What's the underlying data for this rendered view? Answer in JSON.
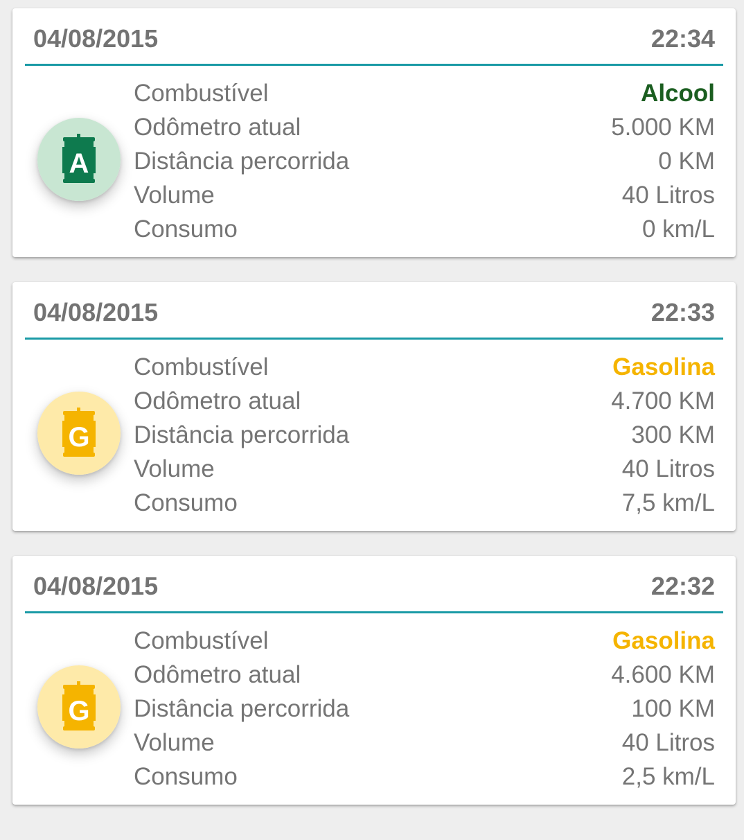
{
  "labels": {
    "fuel": "Combustível",
    "odometer": "Odômetro atual",
    "distance": "Distância percorrida",
    "volume": "Volume",
    "consumption": "Consumo"
  },
  "entries": [
    {
      "date": "04/08/2015",
      "time": "22:34",
      "fuel": "Alcool",
      "fuel_color": "#1b5e20",
      "icon": "fuel-can-alcool-icon",
      "icon_letter": "A",
      "icon_color": "#0e7a4e",
      "icon_bg": "#c8e6d2",
      "odometer": "5.000 KM",
      "distance": "0 KM",
      "volume": "40 Litros",
      "consumption": "0 km/L"
    },
    {
      "date": "04/08/2015",
      "time": "22:33",
      "fuel": "Gasolina",
      "fuel_color": "#f5b400",
      "icon": "fuel-can-gasolina-icon",
      "icon_letter": "G",
      "icon_color": "#f5b400",
      "icon_bg": "#feeaa9",
      "odometer": "4.700 KM",
      "distance": "300 KM",
      "volume": "40 Litros",
      "consumption": "7,5 km/L"
    },
    {
      "date": "04/08/2015",
      "time": "22:32",
      "fuel": "Gasolina",
      "fuel_color": "#f5b400",
      "icon": "fuel-can-gasolina-icon",
      "icon_letter": "G",
      "icon_color": "#f5b400",
      "icon_bg": "#feeaa9",
      "odometer": "4.600 KM",
      "distance": "100 KM",
      "volume": "40 Litros",
      "consumption": "2,5 km/L"
    }
  ]
}
